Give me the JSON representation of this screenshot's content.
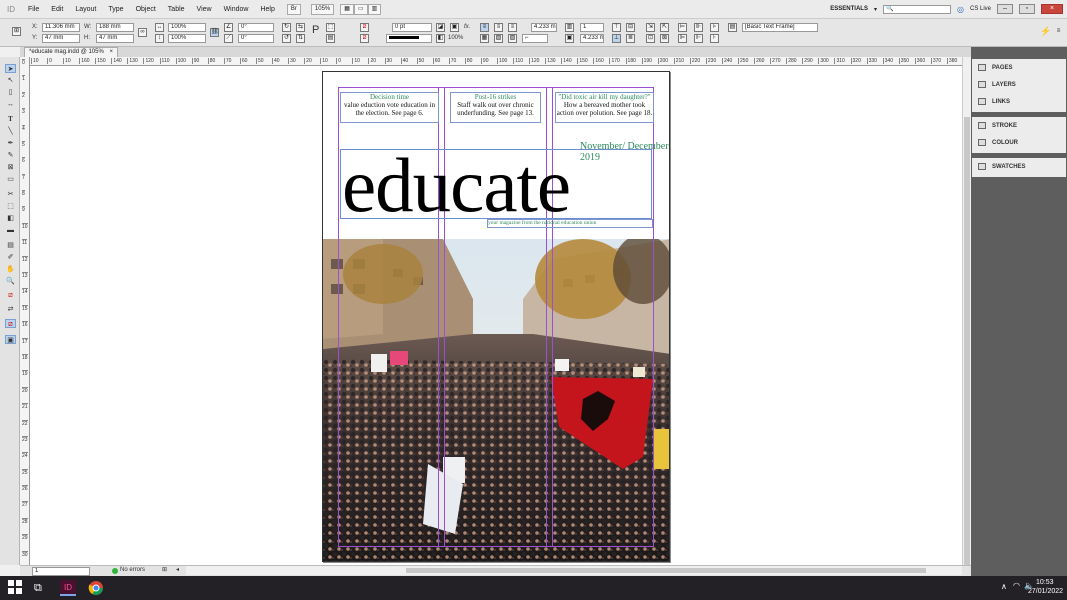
{
  "menubar": {
    "app_logo": "ID",
    "items": [
      "File",
      "Edit",
      "Layout",
      "Type",
      "Object",
      "Table",
      "View",
      "Window",
      "Help"
    ],
    "zoom": "105%",
    "workspace": "ESSENTIALS",
    "cs_live": "CS Live"
  },
  "control": {
    "x_value": "11.306 mm",
    "y_value": "47 mm",
    "w_value": "188 mm",
    "h_value": "47 mm",
    "scale_x": "100%",
    "scale_y": "100%",
    "rotate": "0°",
    "shear": "0°",
    "stroke_weight": "0 pt",
    "opacity": "100%",
    "gutter": "4.233 mm",
    "columns": "1",
    "inset": "4.233 m",
    "style_label": "[Basic Text Frame]",
    "x_label": "X:",
    "y_label": "Y:",
    "w_label": "W:",
    "h_label": "H:"
  },
  "tab": {
    "title": "*educate mag.indd @ 105%",
    "close": "×"
  },
  "ruler": {
    "h_ticks": [
      "10",
      "0",
      "10",
      "160",
      "150",
      "140",
      "130",
      "120",
      "110",
      "100",
      "90",
      "80",
      "70",
      "60",
      "50",
      "40",
      "30",
      "20",
      "10",
      "0",
      "10",
      "20",
      "30",
      "40",
      "50",
      "60",
      "70",
      "80",
      "90",
      "100",
      "110",
      "120",
      "130",
      "140",
      "150",
      "160",
      "170",
      "180",
      "190",
      "200",
      "210",
      "220",
      "230",
      "240",
      "250",
      "260",
      "270",
      "280",
      "290",
      "300",
      "310",
      "320",
      "330",
      "340",
      "350",
      "360",
      "370",
      "380"
    ],
    "v_ticks": [
      "0",
      "1",
      "2",
      "3",
      "4",
      "5",
      "6",
      "7",
      "8",
      "9",
      "10",
      "11",
      "12",
      "13",
      "14",
      "15",
      "16",
      "17",
      "18",
      "19",
      "20",
      "21",
      "22",
      "23",
      "24",
      "25",
      "26",
      "27",
      "28",
      "29",
      "30"
    ]
  },
  "page": {
    "headers": [
      {
        "caption": "Decision time",
        "body": "value eduction vote education in the election. See page 6."
      },
      {
        "caption": "Post-16 strikes",
        "body": "Staff walk out over chronic underfunding. See page 13."
      },
      {
        "caption": "\"Did toxic air kill my daughter?\"",
        "body": "How a bereaved mother took action over polution. See page 18."
      }
    ],
    "masthead": "educate",
    "date": "November/ December 2019",
    "tagline": "your magazine from the national education union"
  },
  "panels": {
    "group1": [
      "PAGES",
      "LAYERS",
      "LINKS"
    ],
    "group2": [
      "STROKE",
      "COLOUR"
    ],
    "group3": [
      "SWATCHES"
    ]
  },
  "status": {
    "page_number": "1",
    "preflight": "No errors"
  },
  "taskbar": {
    "time": "10:53",
    "date": "27/01/2022"
  }
}
